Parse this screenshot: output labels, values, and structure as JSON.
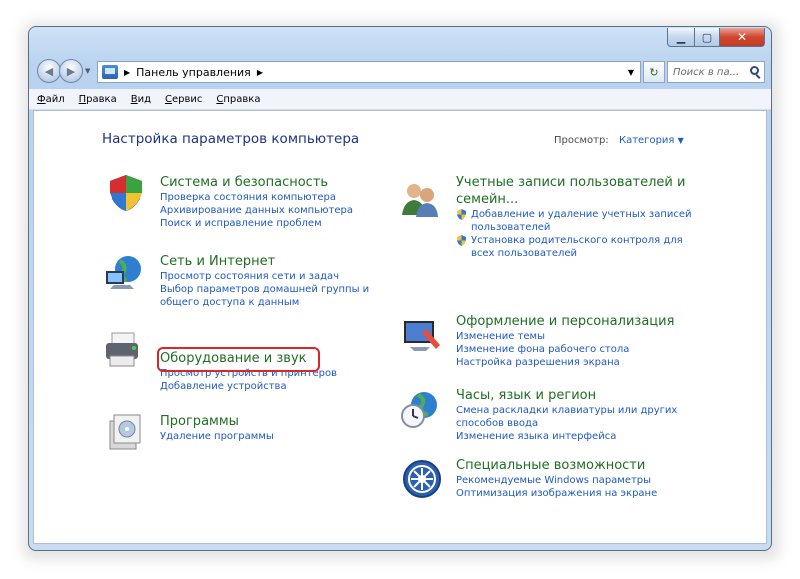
{
  "address": {
    "crumb": "Панель управления"
  },
  "search": {
    "placeholder": "Поиск в па..."
  },
  "menu": {
    "file": {
      "u": "Ф",
      "rest": "айл"
    },
    "edit": {
      "u": "П",
      "rest": "равка"
    },
    "view": {
      "u": "В",
      "rest": "ид"
    },
    "tools": {
      "u": "С",
      "rest": "ервис"
    },
    "help": {
      "u": "С",
      "rest": "правка"
    }
  },
  "main": {
    "heading": "Настройка параметров компьютера",
    "view_label": "Просмотр:",
    "view_value": "Категория"
  },
  "categories": {
    "system": {
      "title": "Система и безопасность",
      "links": [
        "Проверка состояния компьютера",
        "Архивирование данных компьютера",
        "Поиск и исправление проблем"
      ]
    },
    "network": {
      "title": "Сеть и Интернет",
      "links": [
        "Просмотр состояния сети и задач",
        "Выбор параметров домашней группы и",
        "общего доступа к данным"
      ]
    },
    "hardware": {
      "title": "Оборудование и звук",
      "links": [
        "Просмотр устройств и принтеров",
        "Добавление устройства"
      ]
    },
    "programs": {
      "title": "Программы",
      "links": [
        "Удаление программы"
      ]
    },
    "accounts": {
      "title_line1": "Учетные записи пользователей и",
      "title_line2": "семейн...",
      "links": [
        "Добавление и удаление учетных записей",
        "пользователей",
        "Установка родительского контроля для",
        "всех пользователей"
      ]
    },
    "appearance": {
      "title": "Оформление и персонализация",
      "links": [
        "Изменение темы",
        "Изменение фона рабочего стола",
        "Настройка разрешения экрана"
      ]
    },
    "clock": {
      "title": "Часы, язык и регион",
      "links": [
        "Смена раскладки клавиатуры или других",
        "способов ввода",
        "Изменение языка интерфейса"
      ]
    },
    "ease": {
      "title": "Специальные возможности",
      "links": [
        "Рекомендуемые Windows параметры",
        "Оптимизация изображения на экране"
      ]
    }
  },
  "colors": {
    "title_green": "#1f6e23",
    "link_blue": "#1f5ac0",
    "heading_blue": "#1e3287",
    "highlight_red": "#d8262b"
  }
}
